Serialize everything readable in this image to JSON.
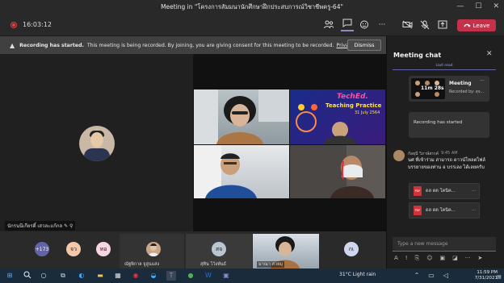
{
  "window": {
    "title": "Meeting in \"โครงการสัมมนานักศึกษาฝึกประสบการณ์วิชาชีพครู-64\"",
    "minimize": "—",
    "maximize": "☐",
    "close": "✕"
  },
  "toolbar": {
    "timer": "16:03:12",
    "leave_label": "Leave",
    "icons": [
      "people-icon",
      "chat-icon",
      "reactions-icon",
      "more-icon",
      "camera-off-icon",
      "mic-off-icon",
      "share-icon"
    ]
  },
  "banner": {
    "title": "Recording has started.",
    "text": "This meeting is being recorded. By joining, you are giving consent for this meeting to be recorded.",
    "link": "Privacy policy",
    "dismiss_label": "Dismiss"
  },
  "main": {
    "speaker_name": "นักรนนีเกียรติ์ เสวละแก้กล"
  },
  "tiles": [
    {
      "name": ""
    },
    {
      "name": "Teaching Practice",
      "banner": "TechEd.",
      "date": "31 July 2564"
    },
    {
      "name": ""
    },
    {
      "name": ""
    }
  ],
  "strip": {
    "more_count": "+173",
    "participants": [
      {
        "initials": "จว",
        "name": ""
      },
      {
        "initials": "ทอ",
        "name": ""
      },
      {
        "initials": "",
        "name": "ณัฐพิกาล จูสูนแสง"
      },
      {
        "initials": "สจ",
        "name": "สุทิน โว้งพันธ์"
      },
      {
        "initials": "",
        "name": "มาณา สวยมุ"
      },
      {
        "initials": "กเ",
        "name": ""
      }
    ]
  },
  "chat": {
    "title": "Meeting chat",
    "last_read": "Last read",
    "meeting_card": {
      "title": "Meeting",
      "subtitle": "Recorded by: สุจ...",
      "duration": "11m 28s"
    },
    "recording_started": "Recording has started",
    "message": {
      "sender": "กัลยุนี วิภาษ์สรรค์",
      "time": "9:45 AM",
      "text": "นศ ที่เข้าร่วม สามารถ ดาวน์โหลดไฟล์ บรรยายของท่าน อ บรรเลง ได้เลยครับ"
    },
    "files": [
      {
        "name": "ดล ดต โคนิค..."
      },
      {
        "name": "ดล ดต โคนิค..."
      }
    ],
    "compose_placeholder": "Type a new message"
  },
  "taskbar": {
    "weather": "31°C  Light rain",
    "time": "11:59 PM",
    "date": "7/31/2021"
  }
}
